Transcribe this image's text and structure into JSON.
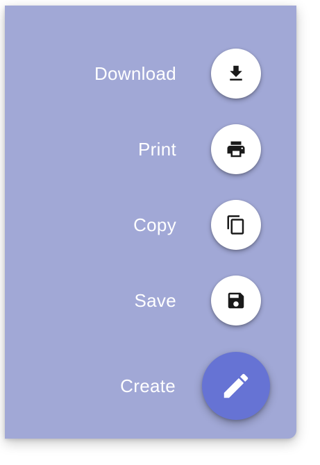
{
  "colors": {
    "panel_background": "#A1A8D6",
    "fab_background": "#FFFFFF",
    "main_fab_background": "#6673D4",
    "icon_dark": "#1A1A1A",
    "label_text": "#FFFFFF"
  },
  "speed_dial": {
    "actions": [
      {
        "label": "Download",
        "icon": "download-icon"
      },
      {
        "label": "Print",
        "icon": "print-icon"
      },
      {
        "label": "Copy",
        "icon": "copy-icon"
      },
      {
        "label": "Save",
        "icon": "save-icon"
      }
    ],
    "main": {
      "label": "Create",
      "icon": "pencil-icon"
    }
  }
}
